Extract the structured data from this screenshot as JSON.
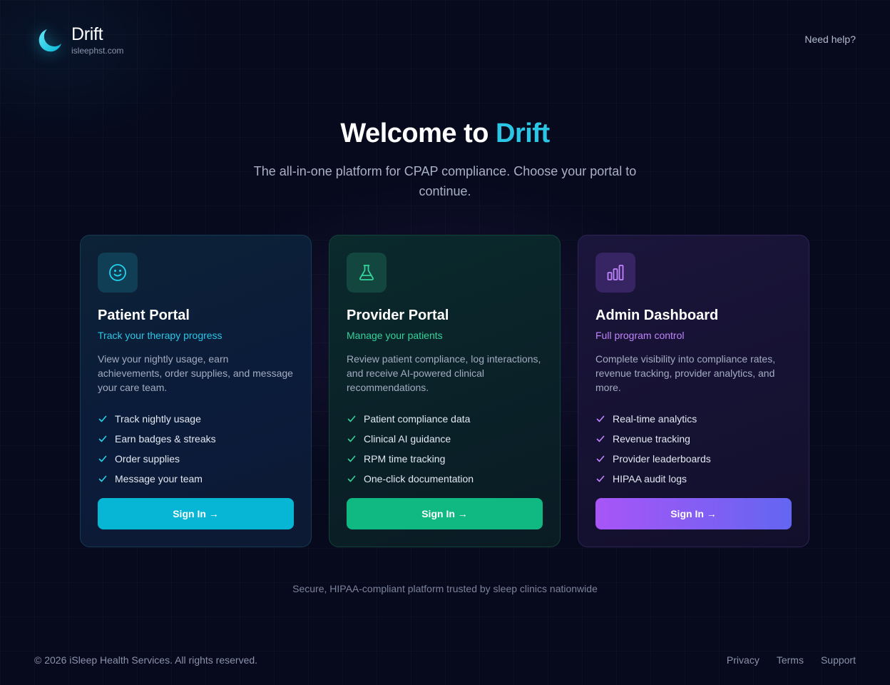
{
  "brand": {
    "name": "Drift",
    "domain": "isleephst.com",
    "logo_icon": "crescent-moon-icon",
    "accent_color": "#22d3ee"
  },
  "header": {
    "help_label": "Need help?"
  },
  "hero": {
    "title_prefix": "Welcome to ",
    "title_accent": "Drift",
    "subtitle": "The all-in-one platform for CPAP compliance. Choose your portal to continue."
  },
  "portals": [
    {
      "title": "Patient Portal",
      "tagline": "Track your therapy progress",
      "description": "View your nightly usage, earn achievements, order supplies, and message your care team.",
      "icon": "smiley-face-icon",
      "accent_color": "#22d3ee",
      "features": [
        "Track nightly usage",
        "Earn badges & streaks",
        "Order supplies",
        "Message your team"
      ],
      "button_label": "Sign In →"
    },
    {
      "title": "Provider Portal",
      "tagline": "Manage your patients",
      "description": "Review patient compliance, log interactions, and receive AI-powered clinical recommendations.",
      "icon": "flask-icon",
      "accent_color": "#34d399",
      "features": [
        "Patient compliance data",
        "Clinical AI guidance",
        "RPM time tracking",
        "One-click documentation"
      ],
      "button_label": "Sign In →"
    },
    {
      "title": "Admin Dashboard",
      "tagline": "Full program control",
      "description": "Complete visibility into compliance rates, revenue tracking, provider analytics, and more.",
      "icon": "bar-chart-icon",
      "accent_color": "#c084fc",
      "features": [
        "Real-time analytics",
        "Revenue tracking",
        "Provider leaderboards",
        "HIPAA audit logs"
      ],
      "button_label": "Sign In →"
    }
  ],
  "trust_line": "Secure, HIPAA-compliant platform trusted by sleep clinics nationwide",
  "footer": {
    "copyright": "© 2026 iSleep Health Services. All rights reserved.",
    "links": [
      "Privacy",
      "Terms",
      "Support"
    ]
  }
}
